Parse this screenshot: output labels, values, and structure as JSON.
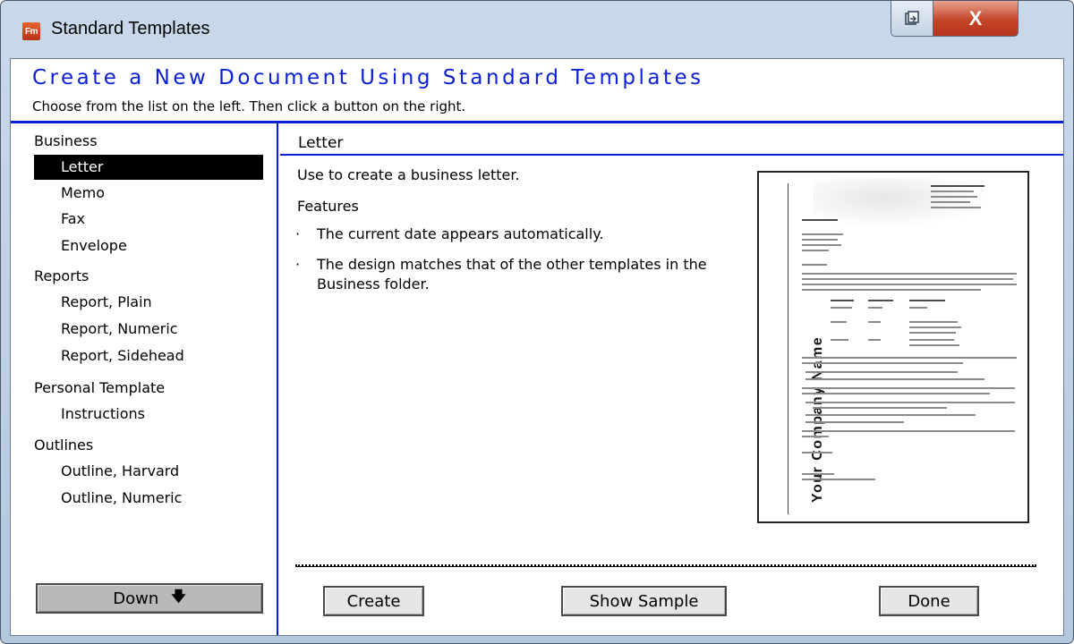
{
  "window": {
    "app_icon_text": "Fm",
    "title": "Standard Templates",
    "close_glyph": "X"
  },
  "header": {
    "title": "Create a New Document Using Standard Templates",
    "subtitle": "Choose from the list on the left. Then click a button on the right."
  },
  "sidebar": {
    "categories": [
      {
        "label": "Business",
        "items": [
          "Letter",
          "Memo",
          "Fax",
          "Envelope"
        ]
      },
      {
        "label": "Reports",
        "items": [
          "Report, Plain",
          "Report, Numeric",
          "Report, Sidehead"
        ]
      },
      {
        "label": "Personal Template",
        "items": [
          "Instructions"
        ]
      },
      {
        "label": "Outlines",
        "items": [
          "Outline, Harvard",
          "Outline, Numeric"
        ]
      }
    ],
    "selected_item": "Letter",
    "down_button": {
      "label": "Down",
      "icon": "arrow-down-icon",
      "glyph": "🡇"
    }
  },
  "detail": {
    "title": "Letter",
    "description": "Use to create a business letter.",
    "features_label": "Features",
    "features": [
      "The current date appears automatically.",
      "The design matches that of the other templates in the Business folder."
    ],
    "preview": {
      "company_name": "Your Company Name"
    }
  },
  "buttons": {
    "create": "Create",
    "show_sample": "Show Sample",
    "done": "Done"
  },
  "colors": {
    "accent_blue": "#0b1fd4",
    "selection": "#000000"
  }
}
